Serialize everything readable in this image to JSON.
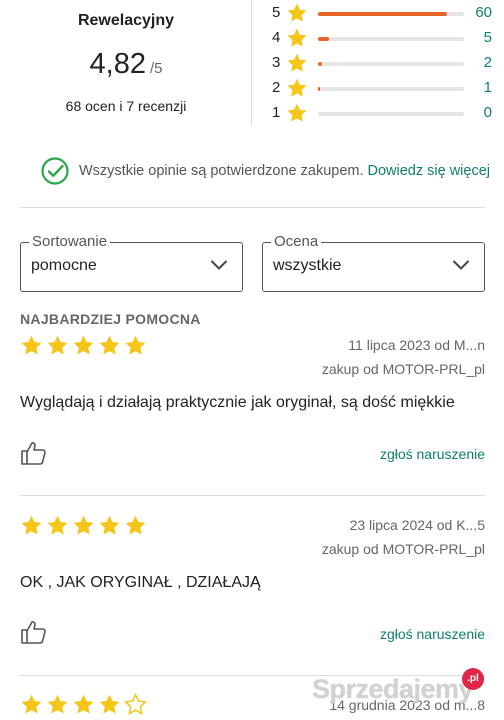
{
  "summary": {
    "label": "Rewelacyjny",
    "average": "4,82",
    "max": "/5",
    "counts": "68 ocen i 7 recenzji",
    "distribution": [
      {
        "stars": "5",
        "count": "60",
        "fraction": 0.882
      },
      {
        "stars": "4",
        "count": "5",
        "fraction": 0.074
      },
      {
        "stars": "3",
        "count": "2",
        "fraction": 0.029
      },
      {
        "stars": "2",
        "count": "1",
        "fraction": 0.015
      },
      {
        "stars": "1",
        "count": "0",
        "fraction": 0.0
      }
    ]
  },
  "verified": {
    "text": "Wszystkie opinie są potwierdzone zakupem.",
    "link": "Dowiedz się więcej"
  },
  "filters": {
    "sort": {
      "label": "Sortowanie",
      "value": "pomocne"
    },
    "rating": {
      "label": "Ocena",
      "value": "wszystkie"
    }
  },
  "section_title": "NAJBARDZIEJ POMOCNA",
  "reviews": [
    {
      "rating": 5,
      "date_author": "11 lipca 2023 od M...n",
      "purchase": "zakup od MOTOR-PRL_pl",
      "text": "Wyglądają i działają praktycznie jak oryginał, są dość miękkie",
      "report": "zgłoś naruszenie"
    },
    {
      "rating": 5,
      "date_author": "23 lipca 2024 od K...5",
      "purchase": "zakup od MOTOR-PRL_pl",
      "text": "OK , JAK ORYGINAŁ , DZIAŁAJĄ",
      "report": "zgłoś naruszenie"
    },
    {
      "rating": 4,
      "date_author": "14 grudnia 2023 od m...8"
    }
  ],
  "colors": {
    "accent": "#0f7f6c",
    "bar": "#e5642a",
    "star": "#f5c518"
  },
  "icons": {
    "verified": "check-circle-icon",
    "dropdown": "chevron-down-icon",
    "like": "thumbs-up-icon",
    "star": "star-icon"
  },
  "watermark": {
    "text": "Sprzedajemy",
    "badge": ".pl"
  }
}
